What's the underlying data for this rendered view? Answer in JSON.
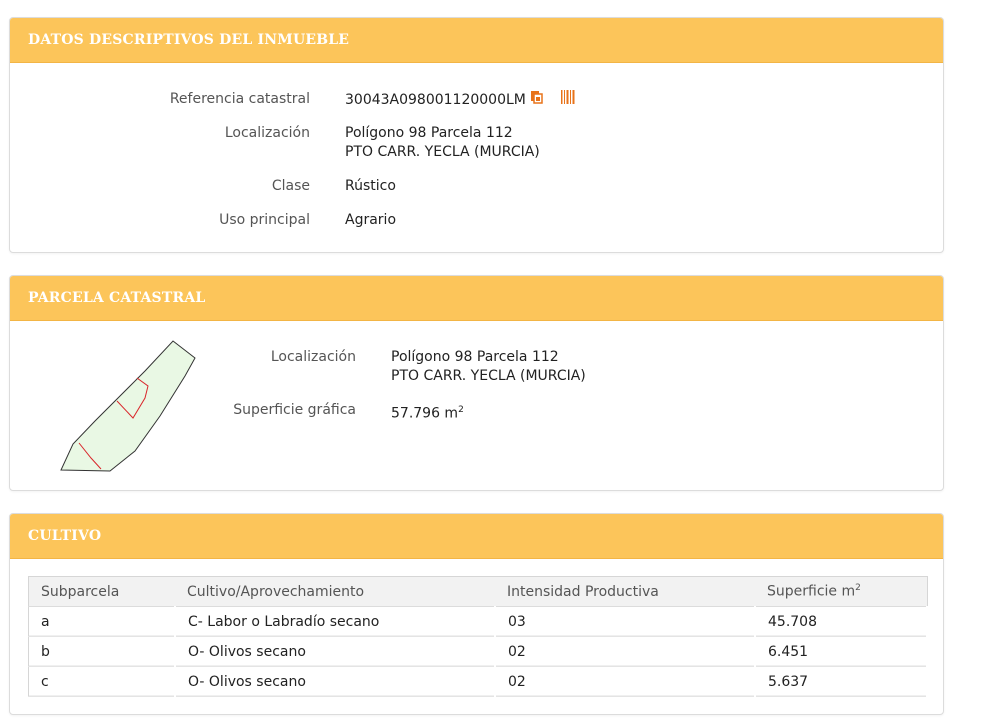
{
  "descriptivos": {
    "title": "DATOS DESCRIPTIVOS DEL INMUEBLE",
    "ref_label": "Referencia catastral",
    "ref_value": "30043A098001120000LM",
    "loc_label": "Localización",
    "loc_line1": "Polígono 98 Parcela 112",
    "loc_line2": "PTO CARR. YECLA (MURCIA)",
    "clase_label": "Clase",
    "clase_value": "Rústico",
    "uso_label": "Uso principal",
    "uso_value": "Agrario",
    "icons": [
      "copy-icon",
      "barcode-icon"
    ],
    "accent": "#e8731a"
  },
  "parcela": {
    "title": "PARCELA CATASTRAL",
    "loc_label": "Localización",
    "loc_line1": "Polígono 98 Parcela 112",
    "loc_line2": "PTO CARR. YECLA (MURCIA)",
    "sup_label": "Superficie gráfica",
    "sup_value": "57.796 m",
    "sup_exp": "2",
    "map_fill": "#e9f8e4",
    "map_line": "#d9252a"
  },
  "cultivo": {
    "title": "CULTIVO",
    "headers": {
      "subparcela": "Subparcela",
      "cultivo": "Cultivo/Aprovechamiento",
      "intensidad": "Intensidad Productiva",
      "superficie": "Superficie m",
      "superficie_exp": "2"
    },
    "rows": [
      {
        "subparcela": "a",
        "cultivo": "C- Labor o Labradío secano",
        "intensidad": "03",
        "superficie": "45.708"
      },
      {
        "subparcela": "b",
        "cultivo": "O- Olivos secano",
        "intensidad": "02",
        "superficie": "6.451"
      },
      {
        "subparcela": "c",
        "cultivo": "O- Olivos secano",
        "intensidad": "02",
        "superficie": "5.637"
      }
    ]
  },
  "theme": {
    "header_bg": "#fcc55a",
    "header_text": "#ffffff"
  }
}
